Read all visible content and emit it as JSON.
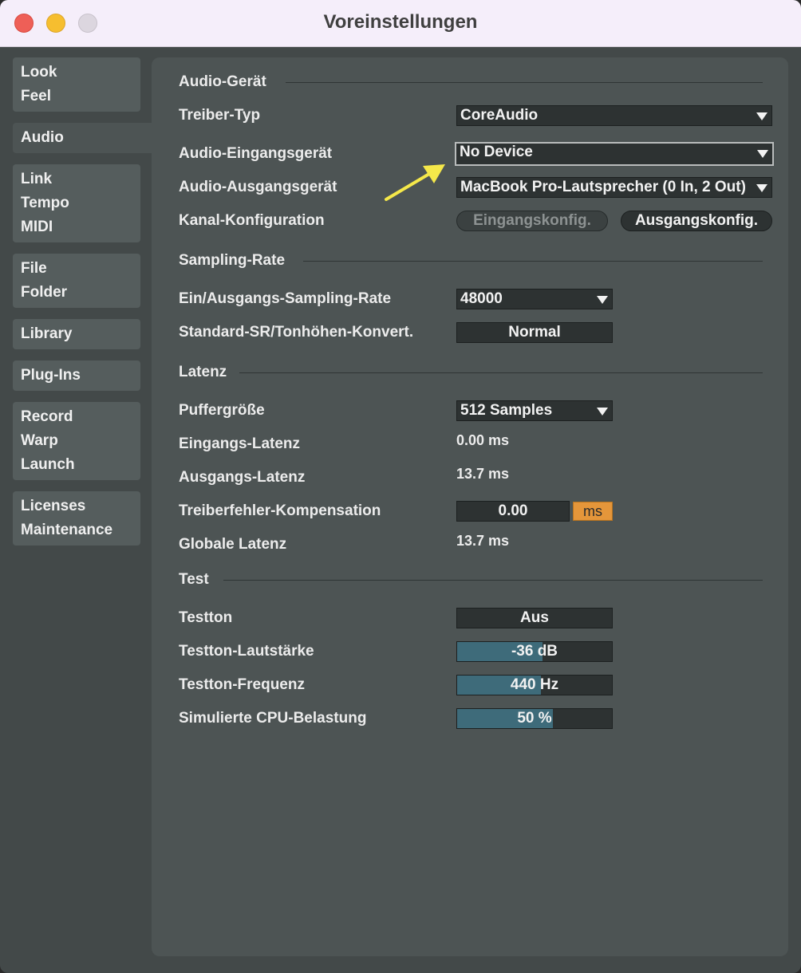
{
  "window": {
    "title": "Voreinstellungen"
  },
  "sidebar": [
    {
      "name": "sidebar-item-look-feel",
      "lines": [
        "Look",
        "Feel"
      ]
    },
    {
      "name": "sidebar-item-audio",
      "lines": [
        "Audio"
      ]
    },
    {
      "name": "sidebar-item-link-tempo-midi",
      "lines": [
        "Link",
        "Tempo",
        "MIDI"
      ]
    },
    {
      "name": "sidebar-item-file-folder",
      "lines": [
        "File",
        "Folder"
      ]
    },
    {
      "name": "sidebar-item-library",
      "lines": [
        "Library"
      ]
    },
    {
      "name": "sidebar-item-plug-ins",
      "lines": [
        "Plug-Ins"
      ]
    },
    {
      "name": "sidebar-item-record-warp-launch",
      "lines": [
        "Record",
        "Warp",
        "Launch"
      ]
    },
    {
      "name": "sidebar-item-licenses-maintenance",
      "lines": [
        "Licenses",
        "Maintenance"
      ]
    }
  ],
  "audio_device": {
    "section": "Audio-Gerät",
    "driver_type_label": "Treiber-Typ",
    "driver_type_value": "CoreAudio",
    "input_device_label": "Audio-Eingangsgerät",
    "input_device_value": "No Device",
    "output_device_label": "Audio-Ausgangsgerät",
    "output_device_value": "MacBook Pro-Lautsprecher (0 In, 2 Out)",
    "channel_config_label": "Kanal-Konfiguration",
    "input_config_button": "Eingangskonfig.",
    "output_config_button": "Ausgangskonfig."
  },
  "sample_rate": {
    "section": "Sampling-Rate",
    "rate_label": "Ein/Ausgangs-Sampling-Rate",
    "rate_value": "48000",
    "conversion_label": "Standard-SR/Tonhöhen-Konvert.",
    "conversion_value": "Normal"
  },
  "latency": {
    "section": "Latenz",
    "buffer_label": "Puffergröße",
    "buffer_value": "512 Samples",
    "input_latency_label": "Eingangs-Latenz",
    "input_latency_value": "0.00 ms",
    "output_latency_label": "Ausgangs-Latenz",
    "output_latency_value": "13.7 ms",
    "driver_comp_label": "Treiberfehler-Kompensation",
    "driver_comp_value": "0.00",
    "driver_comp_unit": "ms",
    "global_latency_label": "Globale Latenz",
    "global_latency_value": "13.7 ms"
  },
  "test": {
    "section": "Test",
    "tone_label": "Testton",
    "tone_value": "Aus",
    "volume_label": "Testton-Lautstärke",
    "volume_value": "-36 dB",
    "volume_fill": 0.55,
    "frequency_label": "Testton-Frequenz",
    "frequency_value": "440 Hz",
    "frequency_fill": 0.54,
    "cpu_label": "Simulierte CPU-Belastung",
    "cpu_value": "50 %",
    "cpu_fill": 0.62
  },
  "colors": {
    "accent": "#e5963a",
    "slider_fill": "#3e6b7a",
    "annotation_arrow": "#f5e84a"
  }
}
